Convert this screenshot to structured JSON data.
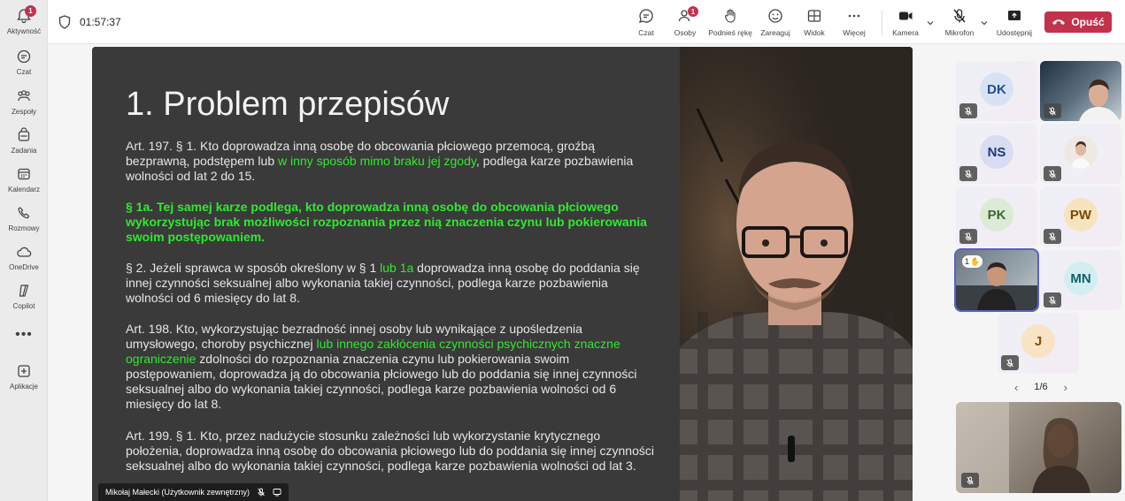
{
  "rail": {
    "items": [
      {
        "label": "Aktywność",
        "badge": "1",
        "icon": "bell-icon"
      },
      {
        "label": "Czat",
        "icon": "chat-icon"
      },
      {
        "label": "Zespoły",
        "icon": "teams-icon"
      },
      {
        "label": "Zadania",
        "icon": "tasks-icon"
      },
      {
        "label": "Kalendarz",
        "icon": "calendar-icon"
      },
      {
        "label": "Rozmowy",
        "icon": "phone-icon"
      },
      {
        "label": "OneDrive",
        "icon": "cloud-icon"
      },
      {
        "label": "Copilot",
        "icon": "copilot-icon"
      },
      {
        "label": "Aplikacje",
        "icon": "add-apps-icon"
      }
    ],
    "more": "•••"
  },
  "meeting": {
    "timer": "01:57:37",
    "toolbar": {
      "chat": "Czat",
      "people": "Osoby",
      "people_badge": "1",
      "raise_hand": "Podnieś rękę",
      "react": "Zareaguj",
      "view": "Widok",
      "more": "Więcej",
      "camera": "Kamera",
      "mic": "Mikrofon",
      "share": "Udostępnij",
      "leave": "Opuść"
    }
  },
  "slide": {
    "title": "1. Problem przepisów",
    "p1": {
      "a": "Art. 197. § 1. Kto doprowadza inną osobę do obcowania płciowego przemocą, groźbą bezprawną, podstępem lub ",
      "hl": "w inny sposób mimo braku jej zgody",
      "b": ", podlega karze pozbawienia wolności od lat 2 do 15."
    },
    "p2": "§ 1a. Tej samej karze podlega, kto doprowadza inną osobę do obcowania płciowego wykorzystując brak możliwości rozpoznania przez nią znaczenia czynu lub pokierowania swoim postępowaniem.",
    "p3": {
      "a": "§ 2.  Jeżeli sprawca w sposób określony w § 1 ",
      "hl": "lub 1a",
      "b": " doprowadza inną osobę do poddania się innej czynności seksualnej albo wykonania takiej czynności, podlega karze pozbawienia wolności od 6 miesięcy do lat 8."
    },
    "p4": {
      "a": "Art. 198. Kto, wykorzystując bezradność innej osoby lub wynikające z upośledzenia umysłowego, choroby psychicznej ",
      "hl": "lub innego zakłócenia czynności psychicznych znaczne ograniczenie",
      "b": " zdolności do rozpoznania znaczenia czynu lub pokierowania swoim postępowaniem, doprowadza ją do obcowania płciowego lub do poddania się innej czynności seksualnej albo do wykonania takiej czynności, podlega karze pozbawienia wolności od 6 miesięcy do lat 8."
    },
    "p5": "Art. 199. § 1. Kto, przez nadużycie stosunku zależności lub wykorzystanie krytycznego położenia, doprowadza inną osobę do obcowania płciowego lub do poddania się innej czynności seksualnej albo do wykonania takiej czynności, podlega karze pozbawienia wolności od lat 3."
  },
  "presenter": {
    "name": "Mikołaj Małecki (Użytkownik zewnętrzny)"
  },
  "participants": [
    {
      "initials": "DK",
      "color": "#1f4e8f",
      "bg": "#d7e3f5"
    },
    {
      "initials": "",
      "video": true
    },
    {
      "initials": "NS",
      "color": "#1f3a7a",
      "bg": "#d9dcf2"
    },
    {
      "initials": "",
      "video": true
    },
    {
      "initials": "PK",
      "color": "#3b6a2e",
      "bg": "#dcebd5"
    },
    {
      "initials": "PW",
      "color": "#7a4a00",
      "bg": "#f8e3bf"
    },
    {
      "initials": "",
      "video": true,
      "hand": "1"
    },
    {
      "initials": "MN",
      "color": "#0f5f6b",
      "bg": "#d3eef0"
    },
    {
      "initials": "J",
      "color": "#8a4b00",
      "bg": "#f9e3c6"
    }
  ],
  "pager": {
    "label": "1/6",
    "prev": "‹",
    "next": "›"
  }
}
